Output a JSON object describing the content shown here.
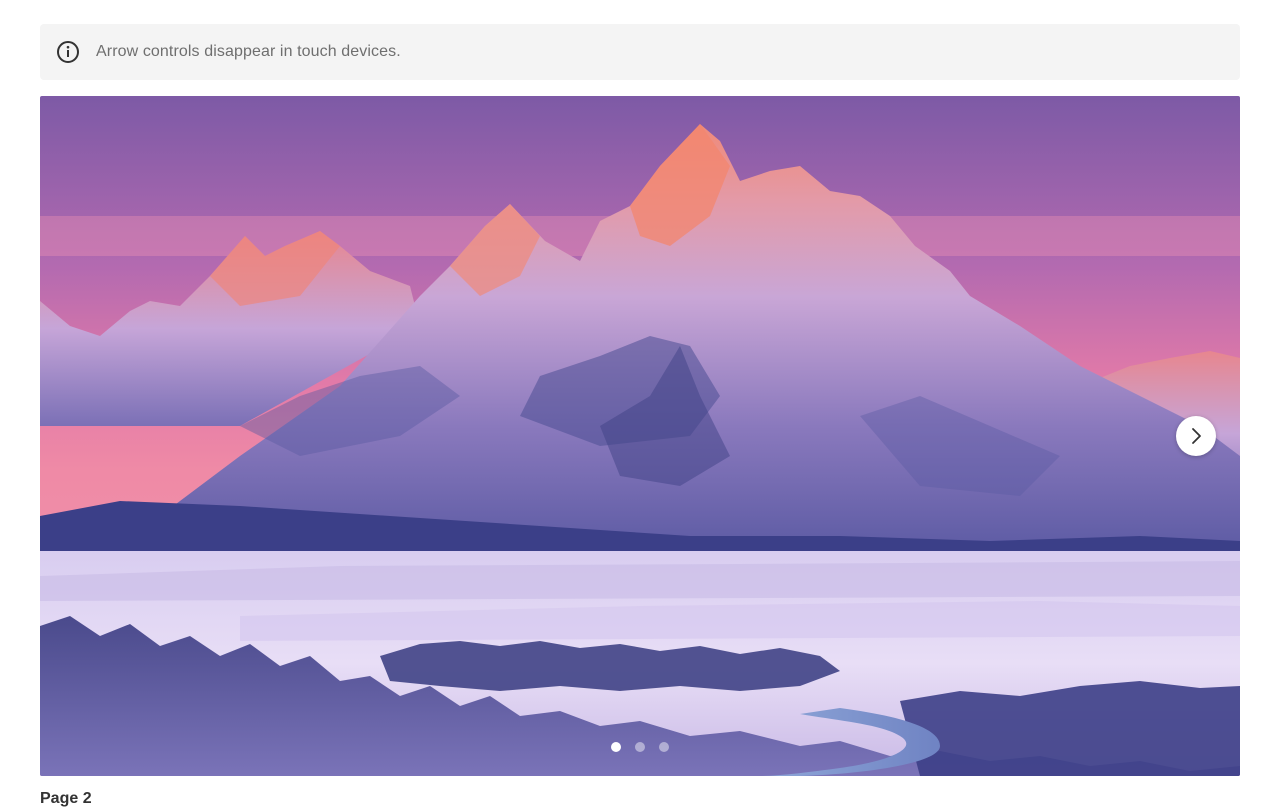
{
  "notice": {
    "icon": "info-icon",
    "text": "Arrow controls disappear in touch devices."
  },
  "carousel": {
    "image": "mountain-landscape-image",
    "next_icon": "chevron-right-icon",
    "slide_count": 3,
    "active_index": 0,
    "caption": "Page 2"
  }
}
